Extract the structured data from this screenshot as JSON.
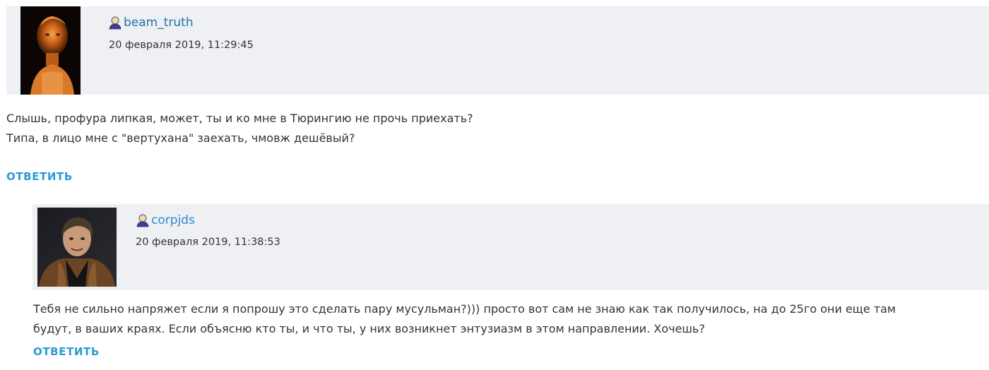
{
  "comments": [
    {
      "username": "beam_truth",
      "timestamp": "20 февраля 2019, 11:29:45",
      "lines": [
        "Слышь, профура липкая, может, ты и ко мне в Тюрингию не прочь приехать?",
        "Типа, в лицо мне с \"вертухана\" заехать, чмовж дешёвый?"
      ],
      "reply_label": "ОТВЕТИТЬ",
      "avatar_icon": "roman-bust-avatar"
    },
    {
      "username": "corpjds",
      "timestamp": "20 февраля 2019, 11:38:53",
      "lines": [
        "Тебя не сильно напряжет если я попрошу это сделать пару мусульман?))) просто вот сам не знаю как так получилось, на до 25го они еще там",
        "будут, в ваших краях. Если объясню кто ты, и что ты, у них возникнет энтузиазм в этом направлении. Хочешь?"
      ],
      "reply_label": "ОТВЕТИТЬ",
      "avatar_icon": "man-photo-avatar"
    }
  ],
  "colors": {
    "header_bg": "#eef0f3",
    "username": "#1f73ae",
    "reply": "#2a9bd6",
    "text": "#333333"
  },
  "icons": {
    "user": "user-icon"
  }
}
